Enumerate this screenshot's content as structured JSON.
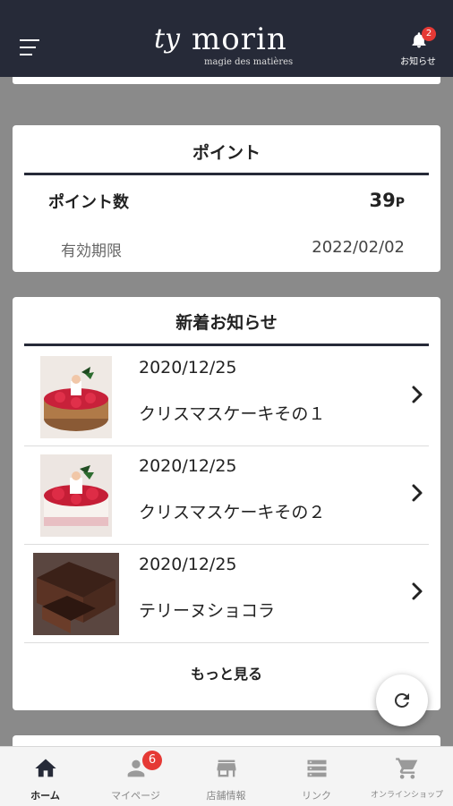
{
  "header": {
    "logo_mark": "ty",
    "logo_text": "morin",
    "logo_tagline": "magie des matières",
    "notification_label": "お知らせ",
    "notification_count": "2"
  },
  "points": {
    "title": "ポイント",
    "points_label": "ポイント数",
    "points_value": "39",
    "points_unit": "P",
    "expiry_label": "有効期限",
    "expiry_value": "2022/02/02"
  },
  "news": {
    "title": "新着お知らせ",
    "items": [
      {
        "date": "2020/12/25",
        "title": "クリスマスケーキその１"
      },
      {
        "date": "2020/12/25",
        "title": "クリスマスケーキその２"
      },
      {
        "date": "2020/12/25",
        "title": "テリーヌショコラ"
      }
    ],
    "more_label": "もっと見る"
  },
  "tabbar": {
    "items": [
      {
        "label": "ホーム",
        "icon": "home-icon"
      },
      {
        "label": "マイページ",
        "icon": "person-icon",
        "badge": "6"
      },
      {
        "label": "店舗情報",
        "icon": "store-icon"
      },
      {
        "label": "リンク",
        "icon": "list-icon"
      },
      {
        "label": "オンラインショップ",
        "icon": "cart-icon"
      }
    ]
  },
  "colors": {
    "header_bg": "#262a38",
    "badge": "#e53935",
    "page_bg": "#8a8a8a"
  }
}
